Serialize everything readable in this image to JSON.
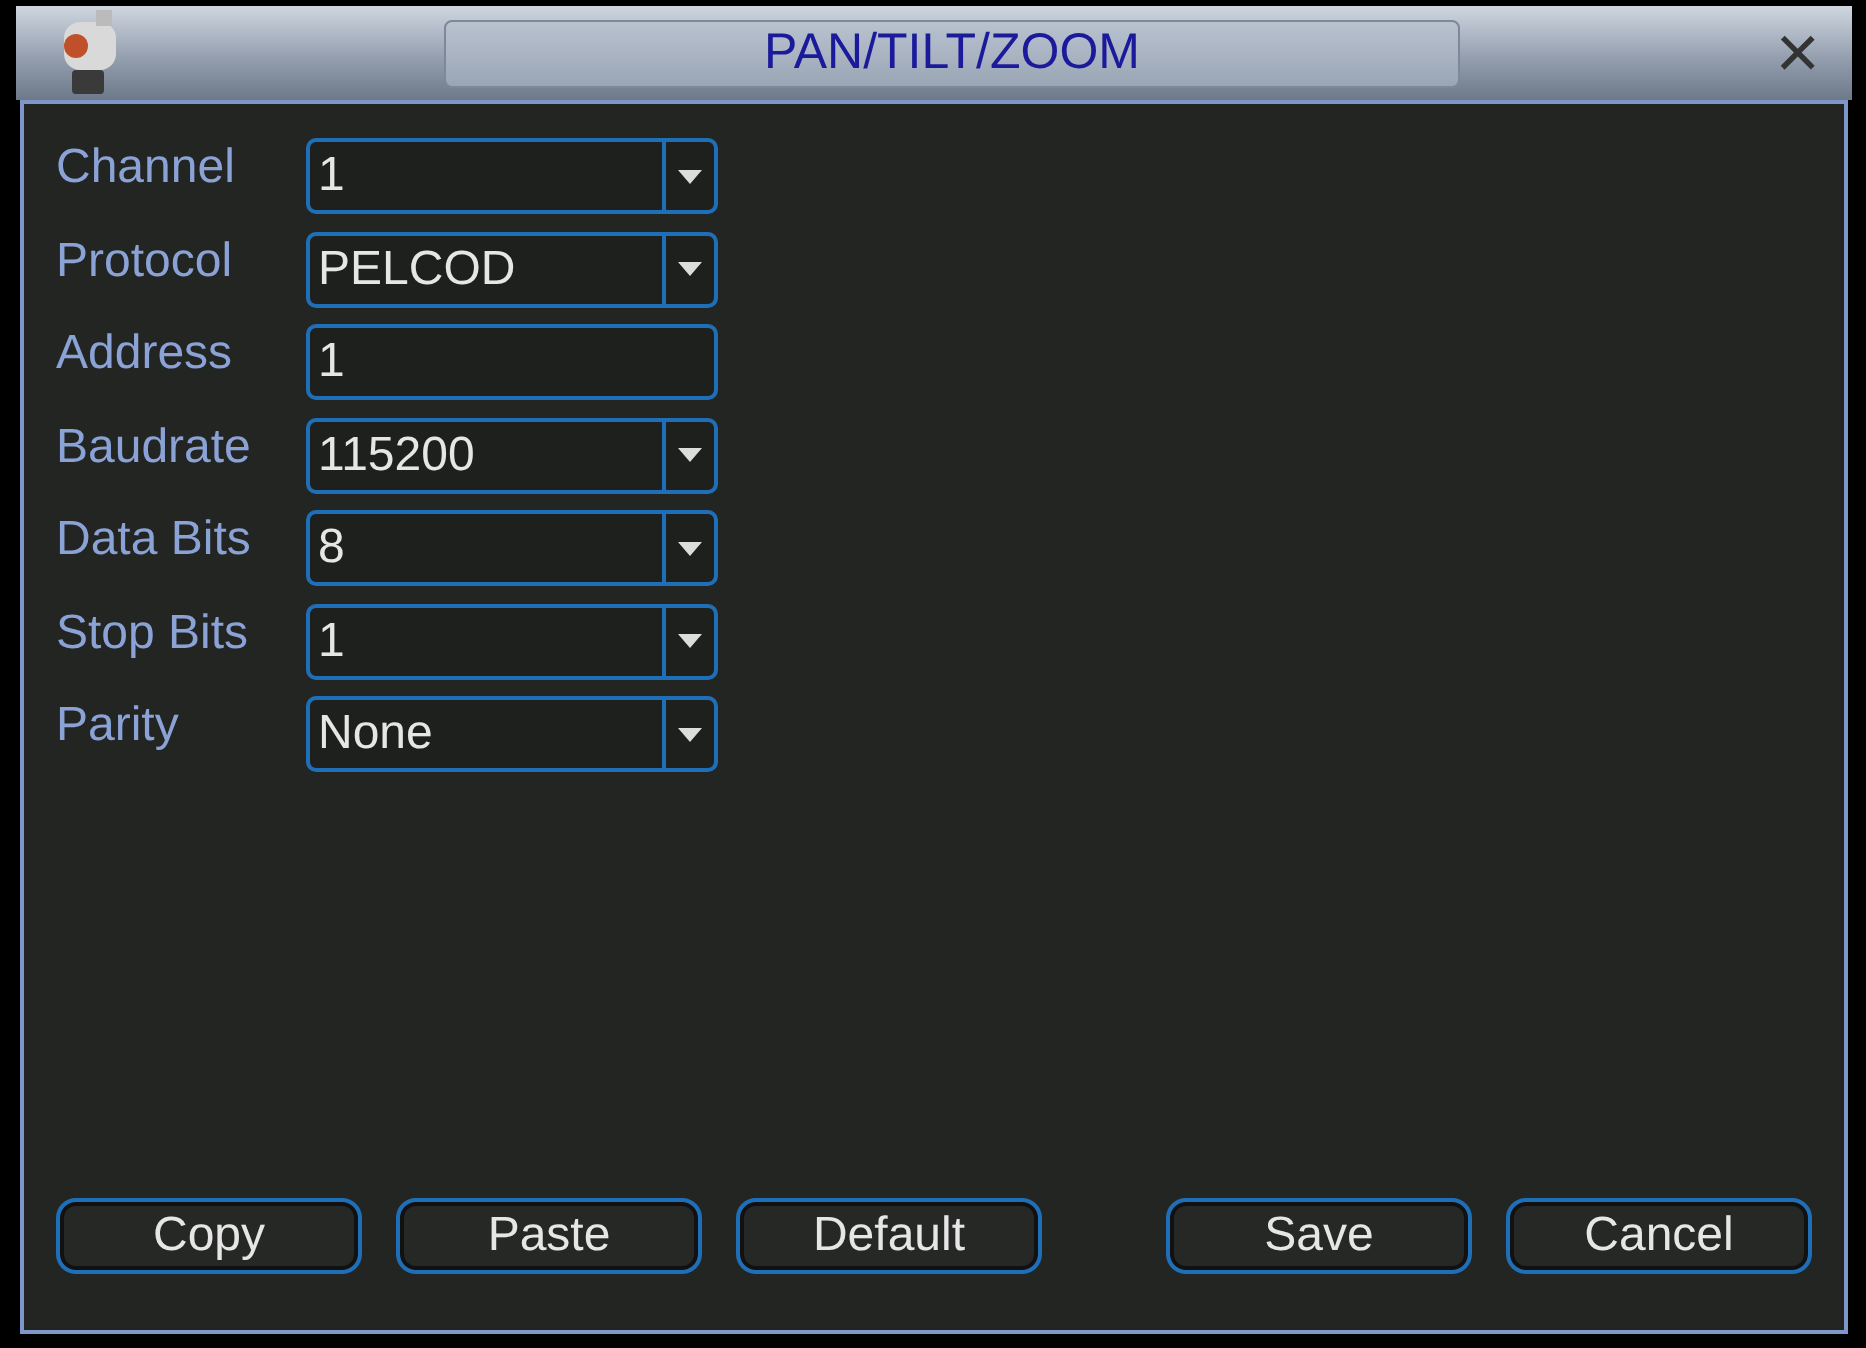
{
  "window": {
    "title": "PAN/TILT/ZOOM",
    "close": "×"
  },
  "fields": [
    {
      "label": "Channel",
      "kind": "select",
      "value": "1"
    },
    {
      "label": "Protocol",
      "kind": "select",
      "value": "PELCOD"
    },
    {
      "label": "Address",
      "kind": "text",
      "value": "1"
    },
    {
      "label": "Baudrate",
      "kind": "select",
      "value": "115200"
    },
    {
      "label": "Data Bits",
      "kind": "select",
      "value": "8"
    },
    {
      "label": "Stop Bits",
      "kind": "select",
      "value": "1"
    },
    {
      "label": "Parity",
      "kind": "select",
      "value": "None"
    }
  ],
  "left_buttons": [
    "Copy",
    "Paste",
    "Default"
  ],
  "right_buttons": [
    "Save",
    "Cancel"
  ]
}
